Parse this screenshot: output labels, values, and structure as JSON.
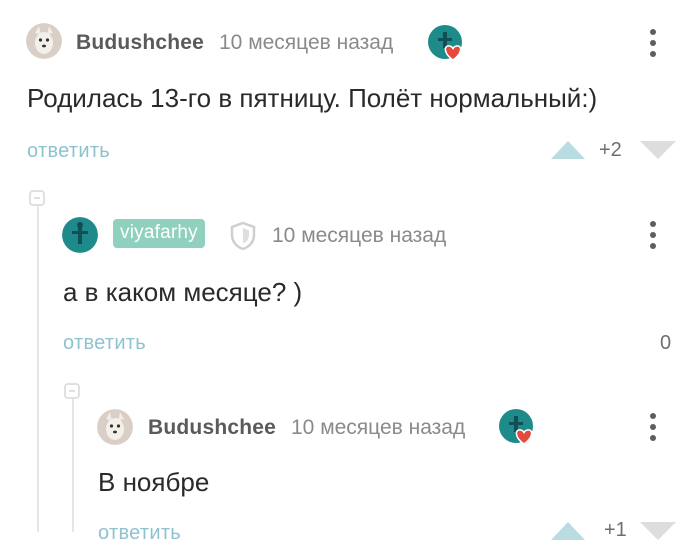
{
  "comments": [
    {
      "username": "Budushchee",
      "time": "10 месяцев назад",
      "text": "Родилась 13-го в пятницу. Полёт нормальный:)",
      "reply_label": "ответить",
      "rating": "+2"
    },
    {
      "username": "viyafarhy",
      "time": "10 месяцев назад",
      "text": "а в каком месяце? )",
      "reply_label": "ответить",
      "rating": "0"
    },
    {
      "username": "Budushchee",
      "time": "10 месяцев назад",
      "text": "В ноябре",
      "reply_label": "ответить",
      "rating": "+1"
    }
  ],
  "colors": {
    "accent": "#8fc2d0",
    "badge": "#8fd0be",
    "vote": "#b9dbe2",
    "heart": "#e5483d",
    "teal_avatar": "#1e8a8a"
  },
  "icons": [
    "user-avatar-dog",
    "heart-badge-icon",
    "shield-icon",
    "more-vertical-icon",
    "upvote-icon",
    "downvote-icon",
    "collapse-thread-icon"
  ]
}
